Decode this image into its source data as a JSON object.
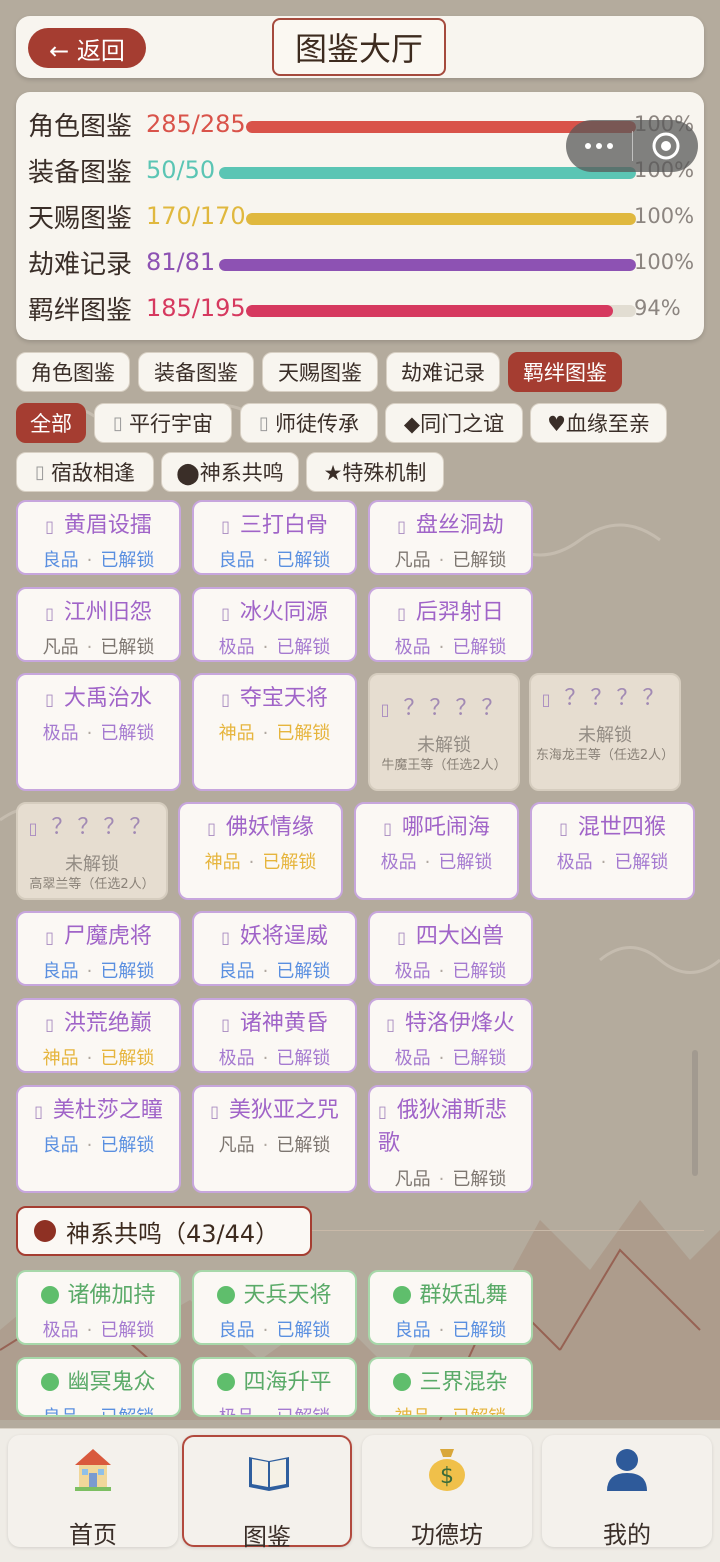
{
  "header": {
    "back_label": "← 返回",
    "title": "图鉴大厅"
  },
  "stats": [
    {
      "label": "角色图鉴",
      "count": "285/285",
      "percent": "100%",
      "fill": 1.0,
      "color": "#d9534a"
    },
    {
      "label": "装备图鉴",
      "count": "50/50",
      "percent": "100%",
      "fill": 1.0,
      "color": "#5bc5b4"
    },
    {
      "label": "天赐图鉴",
      "count": "170/170",
      "percent": "100%",
      "fill": 1.0,
      "color": "#e0b83e"
    },
    {
      "label": "劫难记录",
      "count": "81/81",
      "percent": "100%",
      "fill": 1.0,
      "color": "#8d52b3"
    },
    {
      "label": "羁绊图鉴",
      "count": "185/195",
      "percent": "94%",
      "fill": 0.94,
      "color": "#d6395f"
    }
  ],
  "tabs": [
    "角色图鉴",
    "装备图鉴",
    "天赐图鉴",
    "劫难记录",
    "羁绊图鉴"
  ],
  "filters": [
    "全部",
    "平行宇宙",
    "师徒传承",
    "◆同门之谊",
    "♥血缘至亲",
    "宿敌相逢",
    "⬤神系共鸣",
    "★特殊机制"
  ],
  "tofu": "▯",
  "sep": "·",
  "cards": [
    {
      "name": "黄眉设擂",
      "quality": "良品",
      "status": "已解锁"
    },
    {
      "name": "三打白骨",
      "quality": "良品",
      "status": "已解锁"
    },
    {
      "name": "盘丝洞劫",
      "quality": "凡品",
      "status": "已解锁"
    },
    {
      "name": "江州旧怨",
      "quality": "凡品",
      "status": "已解锁"
    },
    {
      "name": "冰火同源",
      "quality": "极品",
      "status": "已解锁"
    },
    {
      "name": "后羿射日",
      "quality": "极品",
      "status": "已解锁"
    },
    {
      "name": "大禹治水",
      "quality": "极品",
      "status": "已解锁"
    },
    {
      "name": "夺宝天将",
      "quality": "神品",
      "status": "已解锁"
    },
    {
      "name": "？？？？",
      "status": "未解锁",
      "hint": "牛魔王等（任选2人）"
    },
    {
      "name": "？？？？",
      "status": "未解锁",
      "hint": "东海龙王等（任选2人）"
    },
    {
      "name": "？？？？",
      "status": "未解锁",
      "hint": "高翠兰等（任选2人）"
    },
    {
      "name": "佛妖情缘",
      "quality": "神品",
      "status": "已解锁"
    },
    {
      "name": "哪吒闹海",
      "quality": "极品",
      "status": "已解锁"
    },
    {
      "name": "混世四猴",
      "quality": "极品",
      "status": "已解锁"
    },
    {
      "name": "尸魔虎将",
      "quality": "良品",
      "status": "已解锁"
    },
    {
      "name": "妖将逞威",
      "quality": "良品",
      "status": "已解锁"
    },
    {
      "name": "四大凶兽",
      "quality": "极品",
      "status": "已解锁"
    },
    {
      "name": "洪荒绝巅",
      "quality": "神品",
      "status": "已解锁"
    },
    {
      "name": "诸神黄昏",
      "quality": "极品",
      "status": "已解锁"
    },
    {
      "name": "特洛伊烽火",
      "quality": "极品",
      "status": "已解锁"
    },
    {
      "name": "美杜莎之瞳",
      "quality": "良品",
      "status": "已解锁"
    },
    {
      "name": "美狄亚之咒",
      "quality": "凡品",
      "status": "已解锁"
    },
    {
      "name": "俄狄浦斯悲歌",
      "quality": "凡品",
      "status": "已解锁"
    }
  ],
  "section": {
    "title": "神系共鸣（43/44）"
  },
  "green_cards": [
    {
      "name": "诸佛加持",
      "quality": "极品",
      "status": "已解锁"
    },
    {
      "name": "天兵天将",
      "quality": "良品",
      "status": "已解锁"
    },
    {
      "name": "群妖乱舞",
      "quality": "良品",
      "status": "已解锁"
    },
    {
      "name": "幽冥鬼众",
      "quality": "良品",
      "status": "已解锁"
    },
    {
      "name": "四海升平",
      "quality": "极品",
      "status": "已解锁"
    },
    {
      "name": "三界混杂",
      "quality": "神品",
      "status": "已解锁"
    }
  ],
  "quality_colors": {
    "良品": "#5a8fe0",
    "凡品": "#7d7670",
    "极品": "#a57ad0",
    "神品": "#e6b53d"
  },
  "nav": [
    {
      "label": "首页",
      "icon": "house-icon"
    },
    {
      "label": "图鉴",
      "icon": "book-icon"
    },
    {
      "label": "功德坊",
      "icon": "money-bag-icon"
    },
    {
      "label": "我的",
      "icon": "user-icon"
    }
  ]
}
